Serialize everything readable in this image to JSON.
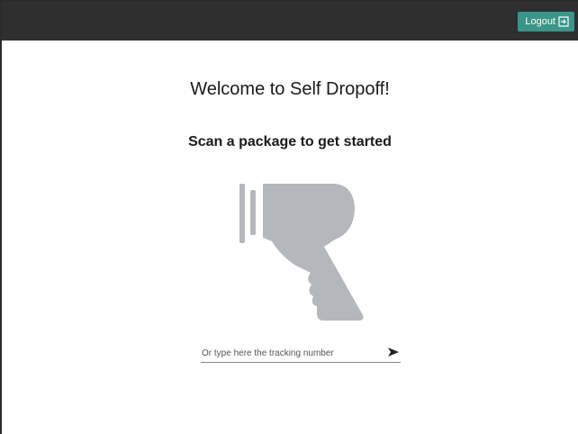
{
  "header": {
    "logout_label": "Logout",
    "logout_icon": "logout-icon",
    "background": "#2f2f2f",
    "button_color": "#3a9688"
  },
  "main": {
    "welcome_text": "Welcome to Self Dropoff!",
    "instruction_text": "Scan a package to get started",
    "scanner_icon": "barcode-scanner-icon",
    "scanner_color": "#b4b8bc",
    "tracking_input": {
      "placeholder": "Or type here the tracking number",
      "value": ""
    },
    "send_icon": "send-icon"
  }
}
